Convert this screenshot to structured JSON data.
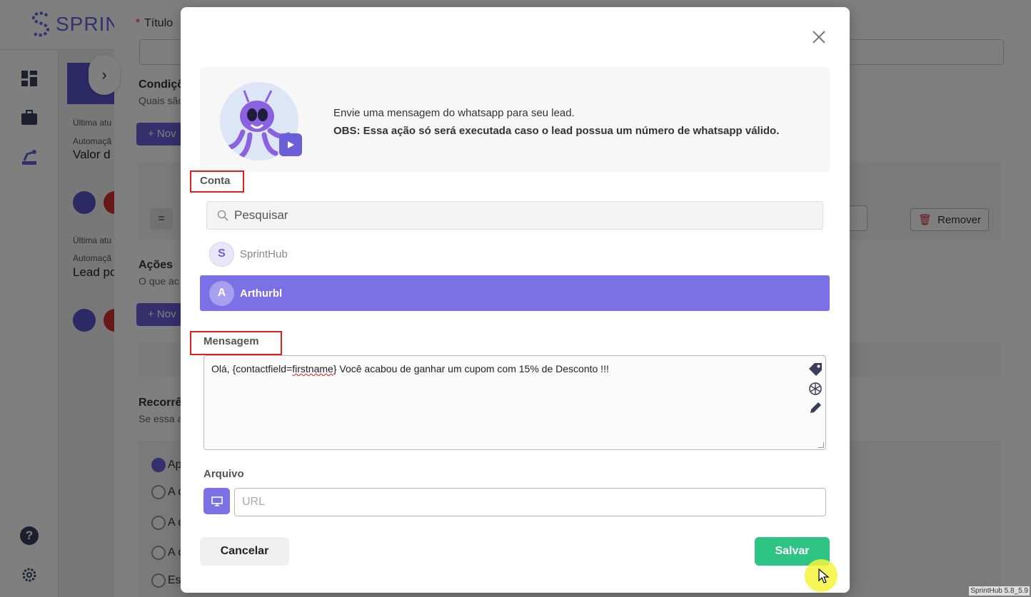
{
  "background_app": {
    "logo_text": "SPRINT",
    "field_title_label": "Título",
    "required_mark": "*",
    "conditions_title": "Condiçõ",
    "conditions_subtitle": "Quais são",
    "new_button_1": "+ Nov",
    "last_update_1": "Última atu",
    "automation_1": "Automaçã",
    "automation_value_1": "Valor d",
    "last_update_2": "Última atu",
    "automation_2": "Automaçã",
    "automation_value_2": "Lead po",
    "actions_title": "Ações",
    "actions_subtitle": "O que ac",
    "new_button_2": "+ Nov",
    "eq_symbol": "=",
    "remove_label": "Remover",
    "recurrence_title": "Recorrê",
    "recurrence_subtitle": "Se essa a",
    "radio_options": [
      "Ap",
      "A c",
      "A c",
      "A c",
      "Es"
    ],
    "col_number": "2"
  },
  "modal": {
    "info_line": "Envie uma mensagem do whatsapp para seu lead.",
    "info_obs": "OBS: Essa ação só será executada caso o lead possua um número de whatsapp válido.",
    "account_label": "Conta",
    "search_placeholder": "Pesquisar",
    "accounts": [
      {
        "initial": "S",
        "name": "SprintHub",
        "selected": false
      },
      {
        "initial": "A",
        "name": "Arthurbl",
        "selected": true
      }
    ],
    "message_label": "Mensagem",
    "message_prefix": "Olá, {contactfield=",
    "message_misspelled": "firstname",
    "message_suffix": "} Você acabou de ganhar um cupom com 15% de Desconto !!!",
    "file_label": "Arquivo",
    "url_placeholder": "URL",
    "cancel_label": "Cancelar",
    "save_label": "Salvar"
  },
  "version_text": "SprintHub 5.8_5.9",
  "colors": {
    "accent": "#7b70e6",
    "save": "#2ec483",
    "highlight_box": "#e02020"
  }
}
